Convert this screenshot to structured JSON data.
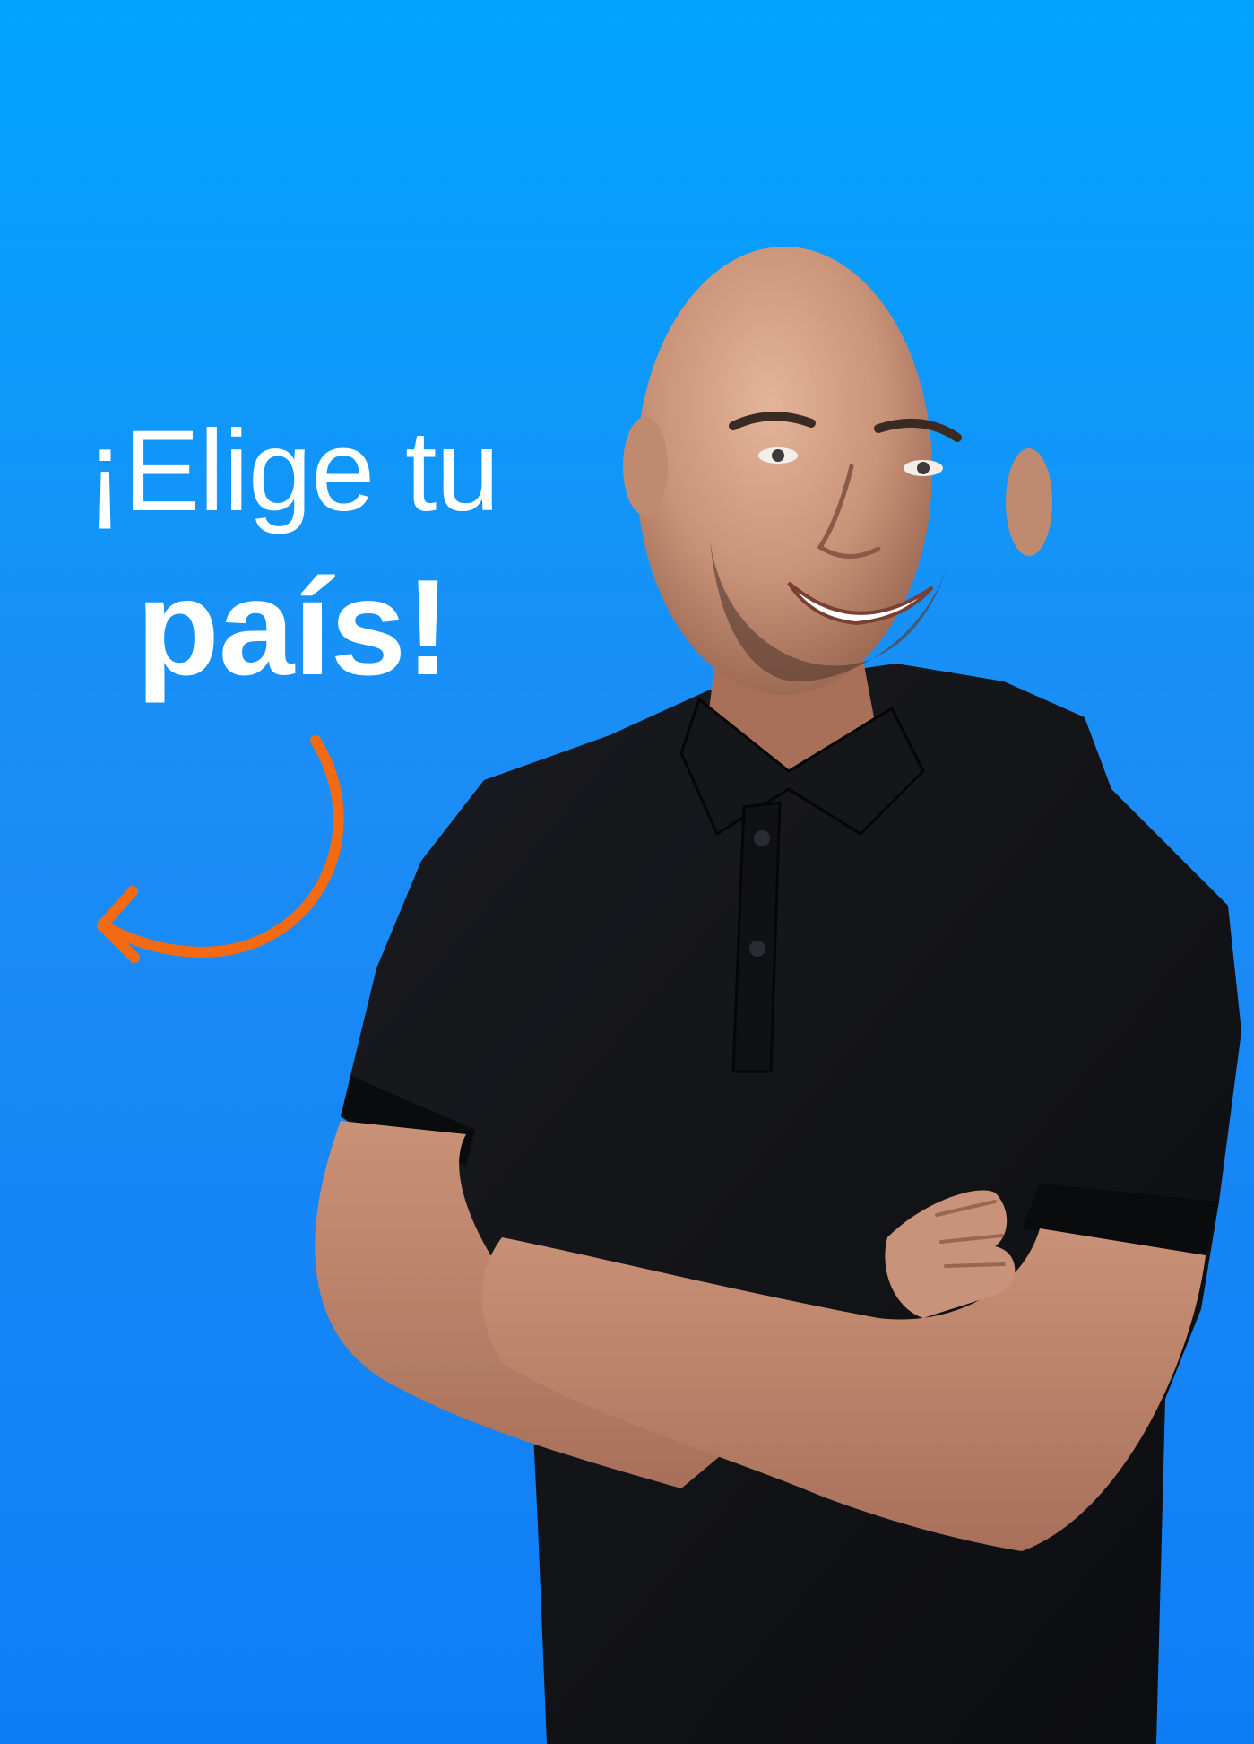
{
  "banner": {
    "headline_line1": "¡Elige tu",
    "headline_line2": "país!",
    "arrow_icon": "curved-arrow-icon",
    "photo": "smiling-man-portrait",
    "colors": {
      "background_top": "#00a4ff",
      "background_bottom": "#0f7ef6",
      "text": "#ffffff",
      "arrow": "#f36a12",
      "shirt": "#121317",
      "skin": "#c48f73"
    }
  }
}
